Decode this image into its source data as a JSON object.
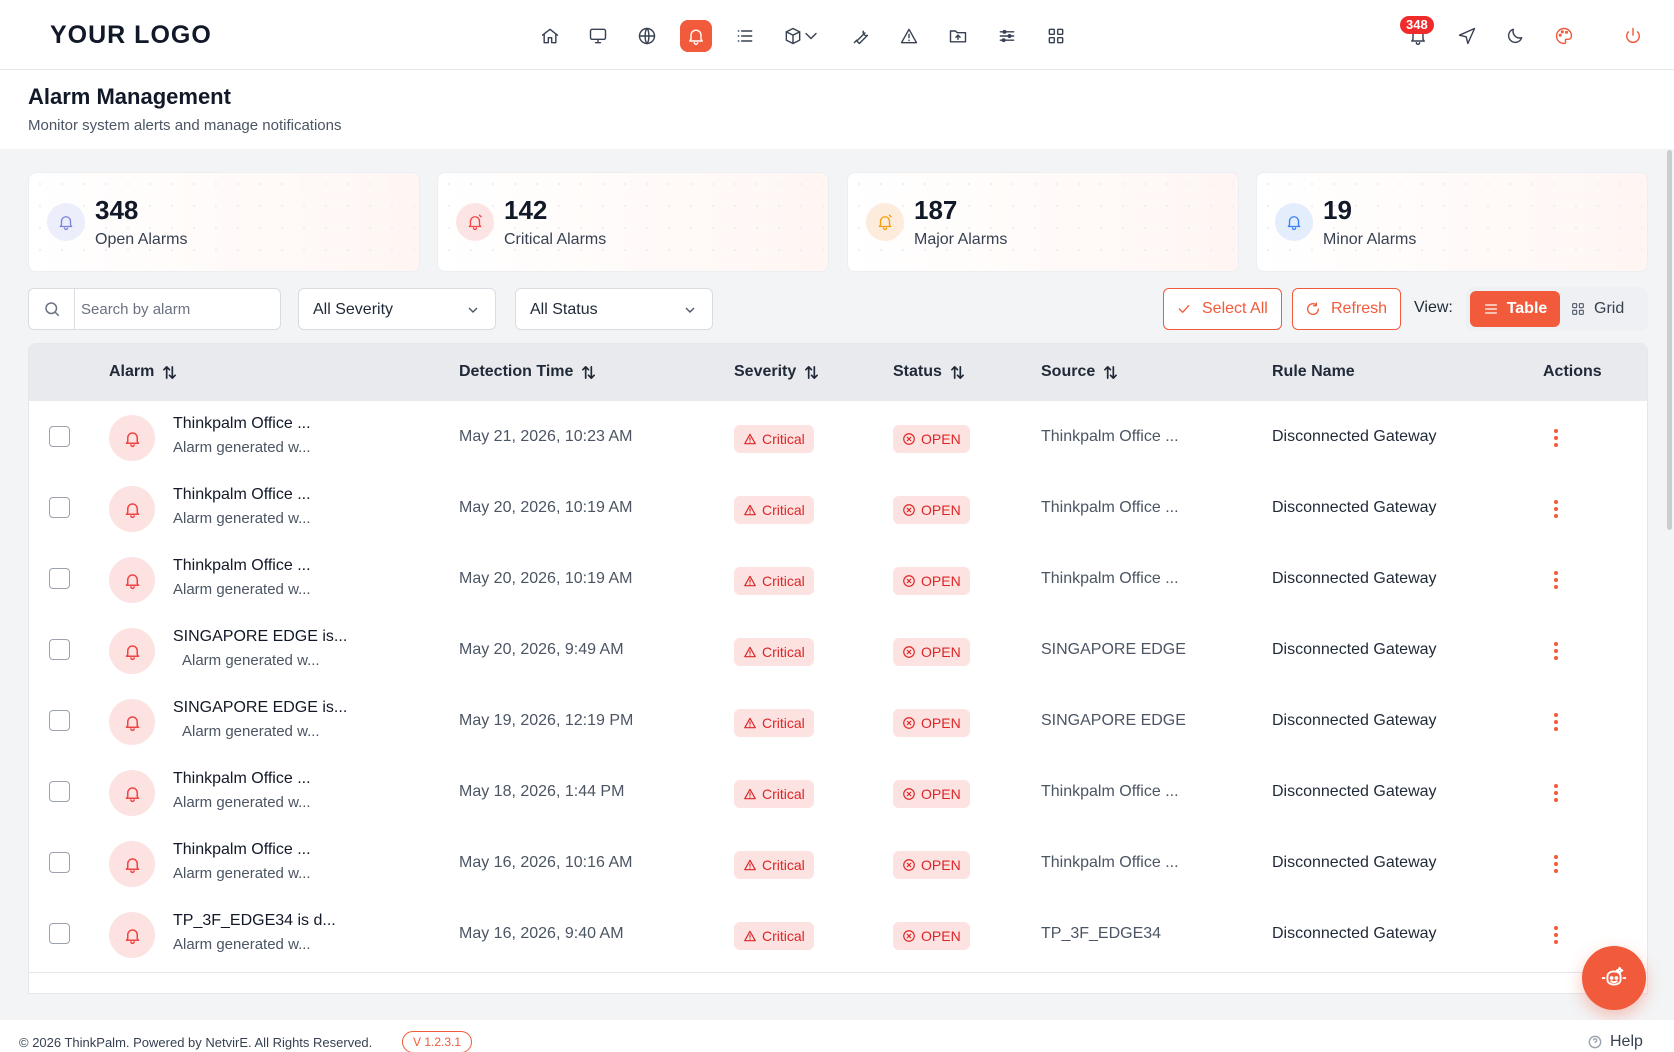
{
  "brand": {
    "logo_text": "YOUR LOGO",
    "accent_color": "#f15a3a"
  },
  "topnav": {
    "icons": [
      "home-icon",
      "monitor-icon",
      "globe-icon",
      "bell-icon",
      "list-icon",
      "box-icon",
      "chevron-down-icon",
      "wrench-icon",
      "warning-icon",
      "folder-icon",
      "sliders-icon",
      "grid-icon"
    ],
    "active_icon": "bell-icon",
    "notification_count": "348",
    "right_icons": [
      "notification-bell-icon",
      "send-icon",
      "moon-icon",
      "palette-icon",
      "power-icon"
    ]
  },
  "header": {
    "title": "Alarm Management",
    "subtitle": "Monitor system alerts and manage notifications"
  },
  "stats": [
    {
      "value": "348",
      "label": "Open Alarms",
      "color": "#7c83db"
    },
    {
      "value": "142",
      "label": "Critical Alarms",
      "color": "#ef4444"
    },
    {
      "value": "187",
      "label": "Major Alarms",
      "color": "#f59e0b"
    },
    {
      "value": "19",
      "label": "Minor Alarms",
      "color": "#3b82f6"
    }
  ],
  "filters": {
    "search_placeholder": "Search by alarm",
    "severity_value": "All Severity",
    "status_value": "All Status",
    "select_all_label": "Select All",
    "refresh_label": "Refresh",
    "view_label": "View:",
    "view_table_label": "Table",
    "view_grid_label": "Grid"
  },
  "table": {
    "columns": [
      "Alarm",
      "Detection Time",
      "Severity",
      "Status",
      "Source",
      "Rule Name",
      "Actions"
    ],
    "rows": [
      {
        "title": "Thinkpalm Office ...",
        "desc": "Alarm generated w...",
        "time": "May 21, 2026, 10:23 AM",
        "severity": "Critical",
        "status": "OPEN",
        "source": "Thinkpalm Office ...",
        "rule": "Disconnected Gateway"
      },
      {
        "title": "Thinkpalm Office ...",
        "desc": "Alarm generated w...",
        "time": "May 20, 2026, 10:19 AM",
        "severity": "Critical",
        "status": "OPEN",
        "source": "Thinkpalm Office ...",
        "rule": "Disconnected Gateway"
      },
      {
        "title": "Thinkpalm Office ...",
        "desc": "Alarm generated w...",
        "time": "May 20, 2026, 10:19 AM",
        "severity": "Critical",
        "status": "OPEN",
        "source": "Thinkpalm Office ...",
        "rule": "Disconnected Gateway"
      },
      {
        "title": "SINGAPORE EDGE is...",
        "desc": "Alarm generated w...",
        "time": "May 20, 2026, 9:49 AM",
        "severity": "Critical",
        "status": "OPEN",
        "source": "SINGAPORE EDGE",
        "rule": "Disconnected Gateway"
      },
      {
        "title": "SINGAPORE EDGE is...",
        "desc": "Alarm generated w...",
        "time": "May 19, 2026, 12:19 PM",
        "severity": "Critical",
        "status": "OPEN",
        "source": "SINGAPORE EDGE",
        "rule": "Disconnected Gateway"
      },
      {
        "title": "Thinkpalm Office ...",
        "desc": "Alarm generated w...",
        "time": "May 18, 2026, 1:44 PM",
        "severity": "Critical",
        "status": "OPEN",
        "source": "Thinkpalm Office ...",
        "rule": "Disconnected Gateway"
      },
      {
        "title": "Thinkpalm Office ...",
        "desc": "Alarm generated w...",
        "time": "May 16, 2026, 10:16 AM",
        "severity": "Critical",
        "status": "OPEN",
        "source": "Thinkpalm Office ...",
        "rule": "Disconnected Gateway"
      },
      {
        "title": "TP_3F_EDGE34 is d...",
        "desc": "Alarm generated w...",
        "time": "May 16, 2026, 9:40 AM",
        "severity": "Critical",
        "status": "OPEN",
        "source": "TP_3F_EDGE34",
        "rule": "Disconnected Gateway"
      }
    ]
  },
  "footer": {
    "copyright": "© 2026 ThinkPalm. Powered by NetvirE. All Rights Reserved.",
    "version": "V 1.2.3.1",
    "help_label": "Help"
  }
}
